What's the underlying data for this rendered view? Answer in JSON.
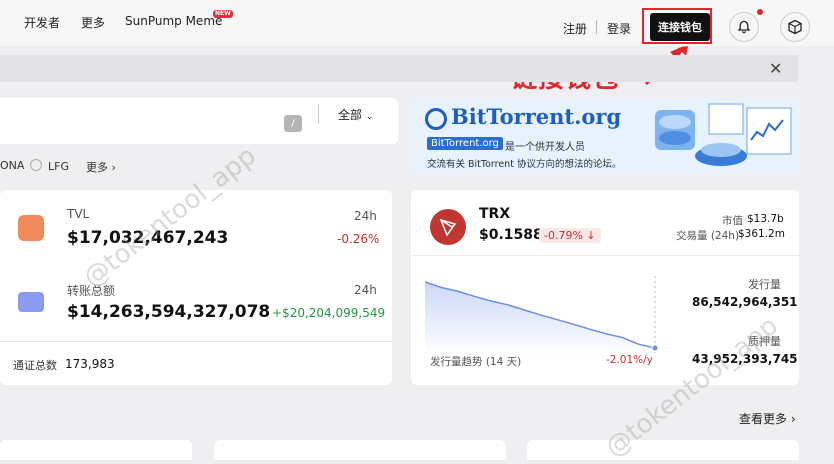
{
  "nav": {
    "developers": "开发者",
    "more": "更多",
    "sunpump": "SunPump Meme",
    "new_badge": "NEW",
    "register": "注册",
    "login": "登录",
    "connect_wallet": "连接钱包"
  },
  "annotation": "链接钱包",
  "search": {
    "shortcut": "/",
    "filter_label": "全部"
  },
  "tags": {
    "t1": "ONA",
    "t2": "LFG",
    "more": "更多"
  },
  "banner": {
    "logo_text": "BitTorrent.org",
    "badge": "BitTorrent.org",
    "line1": "是一个供开发人员",
    "line2": "交流有关 BitTorrent 协议方向的想法的论坛。"
  },
  "stats": {
    "tvl_label": "TVL",
    "tvl_value": "$17,032,467,243",
    "tvl_period": "24h",
    "tvl_change": "-0.26%",
    "transfer_label": "转账总额",
    "transfer_value": "$14,263,594,327,078",
    "transfer_period": "24h",
    "transfer_change": "+$20,204,099,549",
    "tokens_label": "通证总数",
    "tokens_value": "173,983"
  },
  "trx": {
    "name": "TRX",
    "price": "$0.1588",
    "change": "-0.79%",
    "mcap_label": "市值",
    "mcap_value": "$13.7b",
    "volume_label": "交易量 (24h)",
    "volume_value": "$361.2m",
    "issued_label": "发行量",
    "issued_value": "86,542,964,351",
    "staked_label": "质押量",
    "staked_value": "43,952,393,745",
    "trend_label": "发行量趋势 (14 天)",
    "trend_rate": "-2.01%/y"
  },
  "view_more": "查看更多",
  "watermark": "@tokentool_app",
  "colors": {
    "negative": "#c6312b",
    "positive": "#1f9a3c",
    "annotation": "#e2262b",
    "trx_red": "#c23631",
    "chart_line": "#6b8ee8"
  },
  "chart_data": {
    "type": "area",
    "title": "发行量趋势 (14 天)",
    "series": [
      {
        "values": [
          100,
          98.7,
          97.8,
          96.6,
          95.5,
          94.6,
          93.4,
          92.2,
          91.1,
          90.0,
          88.8,
          87.7,
          86.8,
          85.2,
          84.3
        ]
      }
    ]
  }
}
